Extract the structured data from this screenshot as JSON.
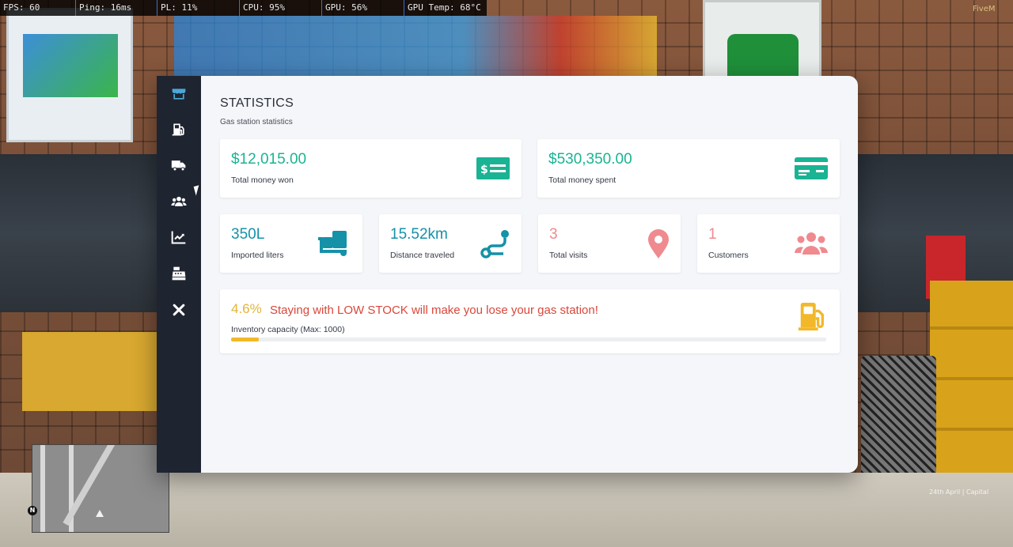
{
  "perf": {
    "fps": "FPS: 60",
    "ping": "Ping: 16ms",
    "pl": "PL: 11%",
    "cpu": "CPU: 95%",
    "gpu": "GPU: 56%",
    "gpu_temp": "GPU Temp: 68°C"
  },
  "watermark": "FiveM",
  "hud": {
    "north": "N",
    "location": "24th April | Capital"
  },
  "sidebar": {
    "items": [
      {
        "icon": "store-icon",
        "color": "#4aa8d8"
      },
      {
        "icon": "fuel-pump-icon",
        "color": "#ffffff"
      },
      {
        "icon": "truck-icon",
        "color": "#ffffff"
      },
      {
        "icon": "users-icon",
        "color": "#ffffff"
      },
      {
        "icon": "chart-line-icon",
        "color": "#ffffff"
      },
      {
        "icon": "cash-register-icon",
        "color": "#ffffff"
      },
      {
        "icon": "close-icon",
        "color": "#ffffff"
      }
    ]
  },
  "page": {
    "title": "STATISTICS",
    "subtitle": "Gas station statistics"
  },
  "stats": {
    "money_won": {
      "value": "$12,015.00",
      "label": "Total money won",
      "icon": "money-bill-icon",
      "color": "#1ab394"
    },
    "money_spent": {
      "value": "$530,350.00",
      "label": "Total money spent",
      "icon": "credit-card-icon",
      "color": "#1ab394"
    },
    "imported_liters": {
      "value": "350L",
      "label": "Imported liters",
      "icon": "dolly-icon",
      "color": "#1591a8"
    },
    "distance": {
      "value": "15.52km",
      "label": "Distance traveled",
      "icon": "route-icon",
      "color": "#1591a8"
    },
    "visits": {
      "value": "3",
      "label": "Total visits",
      "icon": "map-marker-icon",
      "color": "#ef8a8f"
    },
    "customers": {
      "value": "1",
      "label": "Customers",
      "icon": "users-group-icon",
      "color": "#ef8a8f"
    }
  },
  "inventory": {
    "percent_text": "4.6%",
    "warning": "Staying with LOW STOCK will make you lose your gas station!",
    "label": "Inventory capacity (Max: 1000)",
    "fill_fraction": 0.046,
    "icon": "gas-pump-icon",
    "accent": "#f2b829"
  }
}
